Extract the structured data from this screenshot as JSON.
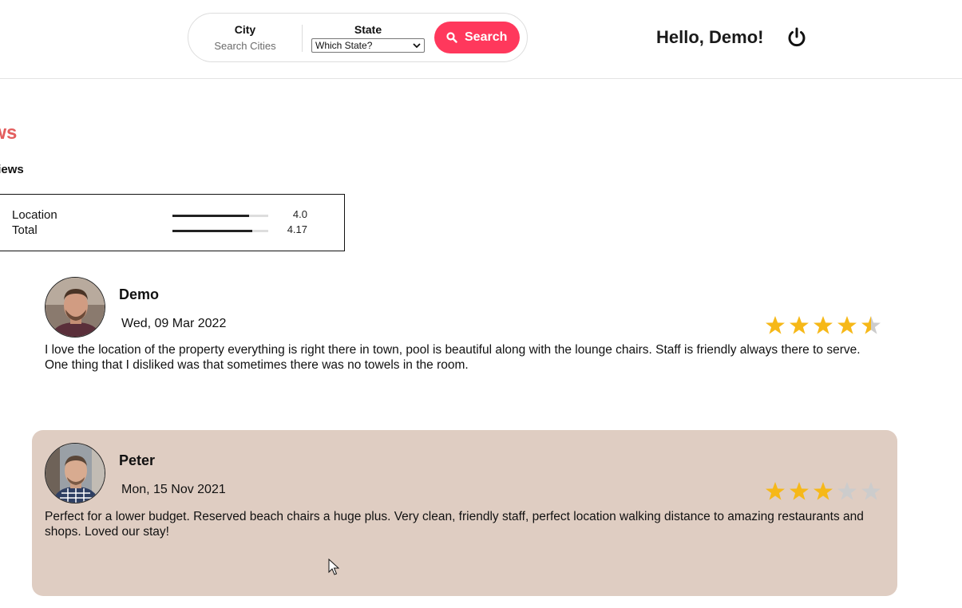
{
  "header": {
    "city_label": "City",
    "city_placeholder": "Search Cities",
    "state_label": "State",
    "state_selected": "Which State?",
    "search_label": "Search",
    "greeting": "Hello, Demo!"
  },
  "reviews_section": {
    "title": "views",
    "total_label": "al reviews",
    "scores": [
      {
        "label": "Location",
        "value": "4.0",
        "fraction": 0.8
      },
      {
        "label": "Total",
        "value": "4.17",
        "fraction": 0.834
      }
    ]
  },
  "reviews": [
    {
      "name": "Demo",
      "date": "Wed, 09 Mar 2022",
      "rating": 4.5,
      "text": "I love the location of the property everything is right there in town, pool is beautiful along with the lounge chairs. Staff is friendly always there to serve. One thing that I disliked was that sometimes there was no towels in the room."
    },
    {
      "name": "Peter",
      "date": "Mon, 15 Nov 2021",
      "rating": 3,
      "text": "Perfect for a lower budget. Reserved beach chairs a huge plus. Very clean, friendly staff, perfect location walking distance to amazing restaurants and shops. Loved our stay!"
    }
  ],
  "colors": {
    "accent": "#ff385c",
    "title_red": "#e35d5d",
    "star_filled": "#f6b818",
    "star_empty": "#cccccc",
    "highlight_card": "#dfcdc2"
  }
}
